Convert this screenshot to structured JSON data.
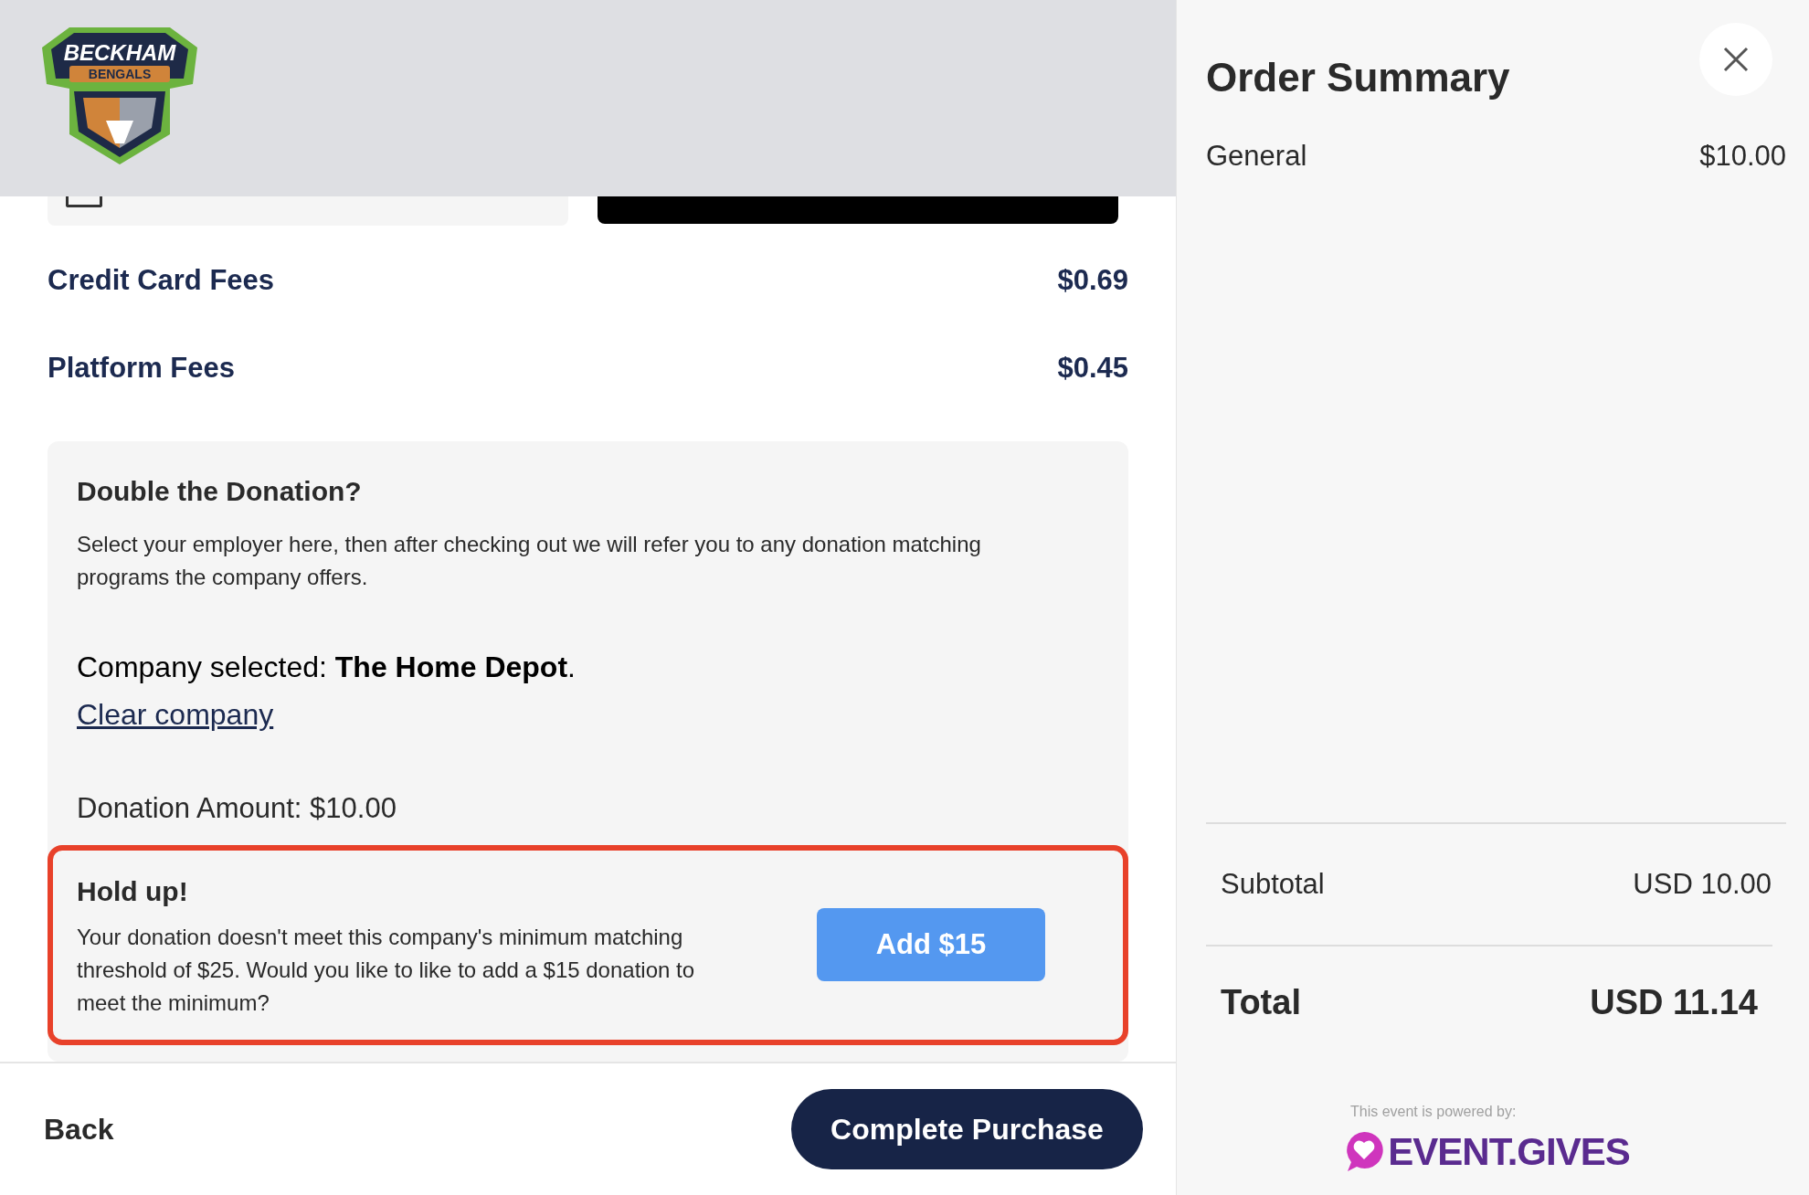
{
  "header": {
    "logo_text": "BECKHAM",
    "logo_subtext": "BENGALS"
  },
  "fees": [
    {
      "label": "Credit Card Fees",
      "amount": "$0.69"
    },
    {
      "label": "Platform Fees",
      "amount": "$0.45"
    }
  ],
  "donation_match": {
    "title": "Double the Donation?",
    "description": "Select your employer here, then after checking out we will refer you to any donation matching programs the company offers.",
    "company_selected": "Company selected: **The Home Depot**.",
    "clear_link": "Clear company",
    "donation_amount": "Donation Amount: $10.00",
    "alert": {
      "title": "Hold up!",
      "message": "Your donation doesn't meet this company's minimum matching threshold of $25. Would you like to like to add a $15 donation to meet the minimum?",
      "button": "Add $15"
    }
  },
  "footer": {
    "back": "Back",
    "submit": "Complete Purchase"
  },
  "order_summary": {
    "title": "Order Summary",
    "items": [
      {
        "name": "General",
        "price": "$10.00"
      }
    ],
    "subtotal_label": "Subtotal",
    "subtotal": "USD 10.00",
    "total_label": "Total",
    "total": "USD 11.14",
    "powered_by": "This event is powered by:",
    "brand": "EVENT.GIVES"
  }
}
